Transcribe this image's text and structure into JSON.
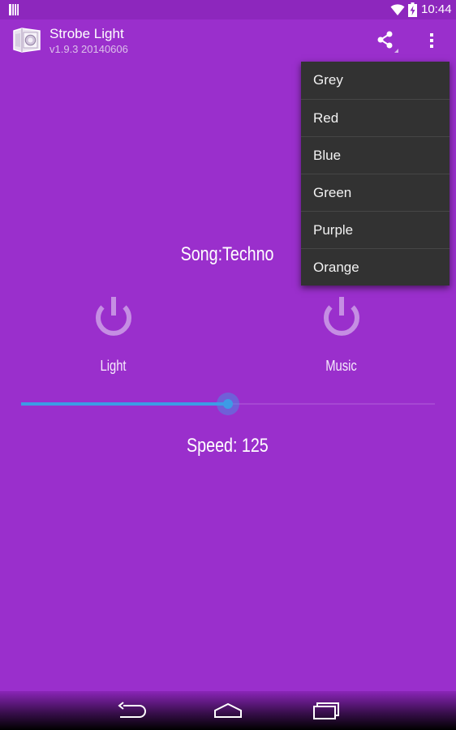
{
  "colors": {
    "background": "#9a2fcc",
    "menu_background": "#323232",
    "accent": "#3d9be6",
    "power_icon": "#c58ee3"
  },
  "status_bar": {
    "time": "10:44",
    "icons": [
      "notification-icon",
      "wifi-icon",
      "battery-charging-icon"
    ]
  },
  "action_bar": {
    "title": "Strobe Light",
    "subtitle": "v1.9.3 20140606",
    "icons": [
      "app-icon",
      "share-icon",
      "overflow-menu-icon"
    ]
  },
  "color_menu": {
    "items": [
      "Grey",
      "Red",
      "Blue",
      "Green",
      "Purple",
      "Orange"
    ]
  },
  "main": {
    "song": "Song:Techno",
    "light_label": "Light",
    "music_label": "Music",
    "speed_text": "Speed: 125",
    "speed_slider_fraction": 0.5
  },
  "nav_bar": {
    "icons": [
      "back-icon",
      "home-icon",
      "recents-icon"
    ]
  }
}
